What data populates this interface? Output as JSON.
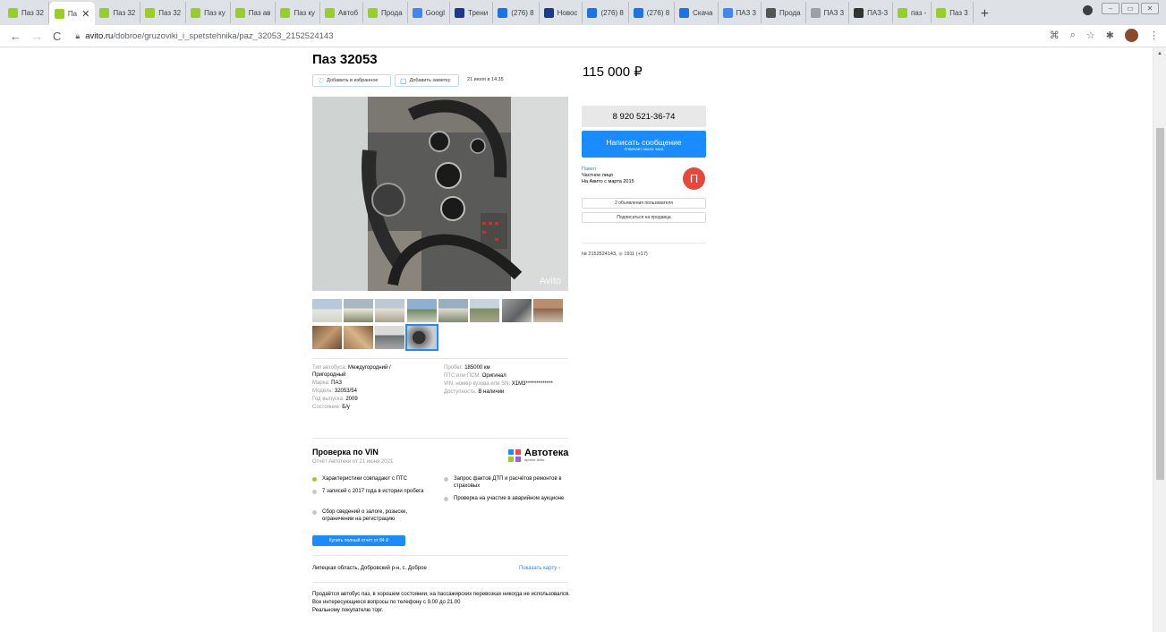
{
  "browser": {
    "tabs": [
      {
        "label": "Паз 32",
        "favicon": "avito",
        "active": false
      },
      {
        "label": "Па",
        "favicon": "avito",
        "active": true
      },
      {
        "label": "Паз 32",
        "favicon": "avito",
        "active": false
      },
      {
        "label": "Паз 32",
        "favicon": "avito",
        "active": false
      },
      {
        "label": "Паз ку",
        "favicon": "avito",
        "active": false
      },
      {
        "label": "Паз ав",
        "favicon": "avito",
        "active": false
      },
      {
        "label": "Паз ку",
        "favicon": "avito",
        "active": false
      },
      {
        "label": "Автоб",
        "favicon": "avito",
        "active": false
      },
      {
        "label": "Прода",
        "favicon": "avito",
        "active": false
      },
      {
        "label": "Googl",
        "favicon": "google",
        "active": false
      },
      {
        "label": "Трени",
        "favicon": "app",
        "active": false
      },
      {
        "label": "(276) 8",
        "favicon": "mail",
        "active": false
      },
      {
        "label": "Новос",
        "favicon": "app",
        "active": false
      },
      {
        "label": "(276) 8",
        "favicon": "mail",
        "active": false
      },
      {
        "label": "(276) 8",
        "favicon": "mail",
        "active": false
      },
      {
        "label": "Скача",
        "favicon": "download",
        "active": false
      },
      {
        "label": "ПАЗ 3",
        "favicon": "google",
        "active": false
      },
      {
        "label": "Прода",
        "favicon": "dots",
        "active": false
      },
      {
        "label": "ПАЗ 3",
        "favicon": "search",
        "active": false
      },
      {
        "label": "ПАЗ-3",
        "favicon": "wiki",
        "active": false
      },
      {
        "label": "паз - ",
        "favicon": "avito",
        "active": false
      },
      {
        "label": "Паз 3",
        "favicon": "avito",
        "active": false
      }
    ],
    "new_tab": "+",
    "url_host": "avito.ru",
    "url_path": "/dobroe/gruzoviki_i_spetstehnika/paz_32053_2152524143"
  },
  "listing": {
    "title": "Паз 32053",
    "add_favorite": "Добавить в избранное",
    "add_note": "Добавить заметку",
    "date": "21 июля в 14:35",
    "price": "115 000 ₽",
    "watermark": "Avito",
    "params_left": [
      {
        "k": "Тип автобуса: ",
        "v": "Междугородний / Пригородный"
      },
      {
        "k": "Марка: ",
        "v": "ПАЗ"
      },
      {
        "k": "Модель: ",
        "v": "32053/54"
      },
      {
        "k": "Год выпуска: ",
        "v": "2009"
      },
      {
        "k": "Состояние: ",
        "v": "Б/у"
      }
    ],
    "params_right": [
      {
        "k": "Пробег: ",
        "v": "185000 км"
      },
      {
        "k": "ПТС или ПСМ: ",
        "v": "Оригинал"
      },
      {
        "k": "VIN, номер кузова или SN: ",
        "v": "X1M3*************"
      },
      {
        "k": "Доступность: ",
        "v": "В наличии"
      }
    ],
    "vin": {
      "title": "Проверка по VIN",
      "subtitle": "Отчёт Автотеки от 21 июня 2021",
      "brand": "Автотека",
      "brand_sub": "проект Avito",
      "checks_left": [
        {
          "text": "Характеристики совпадают с ПТС",
          "status": "ok"
        },
        {
          "text": "7 записей с 2017 года в истории пробега",
          "status": "locked"
        },
        {
          "text": "Сбор сведений о залоге, розыске, ограничении на регистрацию",
          "status": "locked"
        }
      ],
      "checks_right": [
        {
          "text": "Запрос фактов ДТП и расчётов ремонтов в страховых",
          "status": "locked"
        },
        {
          "text": "Проверка на участие в аварийном аукционе",
          "status": "locked"
        }
      ],
      "buy_button": "Купить полный отчёт от 84 ₽"
    },
    "location": "Липецкая область, Добровский р-н, с. Доброе",
    "show_map": "Показать карту",
    "description": [
      "Продаётся автобус паз, в хорошем состоянии, на пассажирских перевозках никогда не использовался.",
      "Все интересующиеся вопросы по телефону с 9.00 до 21.00",
      "Реальному покупателю торг."
    ]
  },
  "seller": {
    "phone": "8 920 521-36-74",
    "write_label": "Написать сообщение",
    "write_sub": "Отвечает около часа",
    "name": "Павел",
    "type": "Частное лицо",
    "since": "На Авито с марта 2015",
    "avatar_letter": "П",
    "ads_button": "2 объявления пользователя",
    "subscribe_button": "Подписаться на продавца",
    "ad_number": "№ 2152524143,",
    "views": "1911 (+17)"
  },
  "colors": {
    "accent": "#1a8cff",
    "avatar": "#e8473b",
    "favicon_avito": "#97cf26"
  }
}
